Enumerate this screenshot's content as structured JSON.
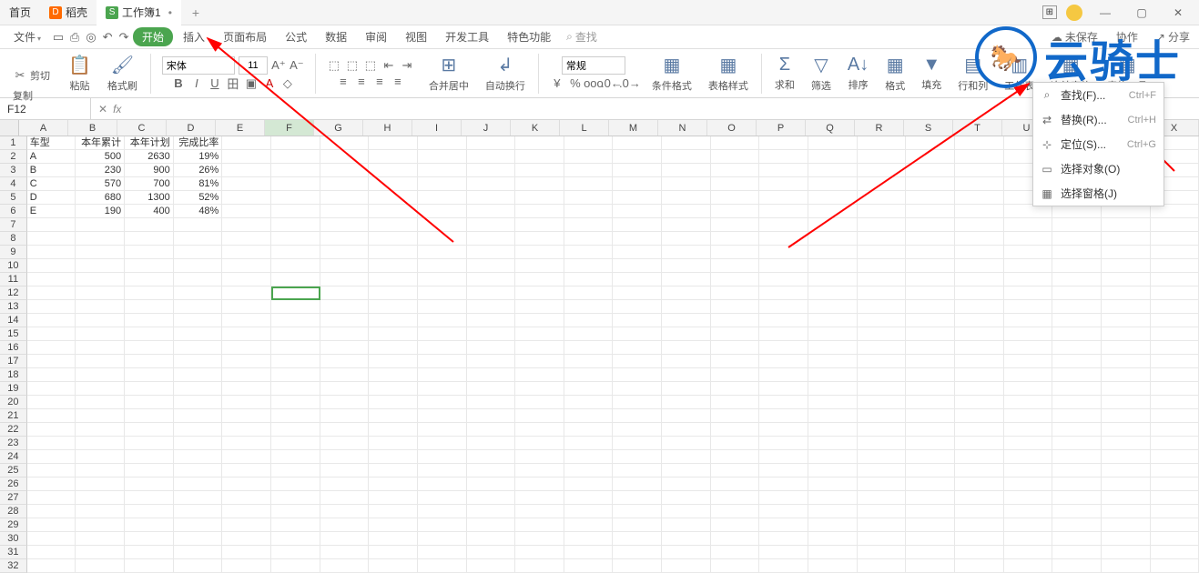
{
  "titlebar": {
    "tabs": [
      {
        "icon": "首",
        "label": "首页",
        "color": ""
      },
      {
        "icon": "D",
        "label": "稻壳",
        "color": "orange"
      },
      {
        "icon": "S",
        "label": "工作簿1",
        "color": "green",
        "active": true
      }
    ],
    "plus": "+"
  },
  "menubar": {
    "file": "文件",
    "items": [
      "开始",
      "插入",
      "页面布局",
      "公式",
      "数据",
      "审阅",
      "视图",
      "开发工具",
      "特色功能"
    ],
    "search_icon": "⌕",
    "search": "查找",
    "unsaved_icon": "☁",
    "unsaved": "未保存",
    "collab": "协作",
    "share_icon": "↗",
    "share": "分享"
  },
  "toolbar": {
    "cut": "剪切",
    "paste": "粘贴",
    "copy": "复制",
    "format_painter": "格式刷",
    "font": "宋体",
    "size": "11",
    "merge": "合并居中",
    "wrap": "自动换行",
    "number_format": "常规",
    "cond_format": "条件格式",
    "table_style": "表格样式",
    "sum": "求和",
    "filter": "筛选",
    "sort": "排序",
    "format": "格式",
    "fill": "填充",
    "row_col": "行和列",
    "sheet": "工作表",
    "freeze": "冻结窗格",
    "table_tools": "表格工具"
  },
  "formula_bar": {
    "cell": "F12",
    "fx": "fx"
  },
  "columns": [
    "A",
    "B",
    "C",
    "D",
    "E",
    "F",
    "G",
    "H",
    "I",
    "J",
    "K",
    "L",
    "M",
    "N",
    "O",
    "P",
    "Q",
    "R",
    "S",
    "T",
    "U",
    "V",
    "W",
    "X"
  ],
  "active_col_index": 5,
  "selected_cell": {
    "row": 12,
    "col": 5
  },
  "data_rows": [
    {
      "h": "1",
      "cells": [
        "车型",
        "本年累计",
        "本年计划",
        "完成比率",
        "",
        "",
        "",
        "",
        "",
        "",
        "",
        "",
        "",
        "",
        "",
        "",
        "",
        "",
        "",
        "",
        "",
        "",
        "",
        ""
      ]
    },
    {
      "h": "2",
      "cells": [
        "A",
        "500",
        "2630",
        "19%",
        "",
        "",
        "",
        "",
        "",
        "",
        "",
        "",
        "",
        "",
        "",
        "",
        "",
        "",
        "",
        "",
        "",
        "",
        "",
        ""
      ]
    },
    {
      "h": "3",
      "cells": [
        "B",
        "230",
        "900",
        "26%",
        "",
        "",
        "",
        "",
        "",
        "",
        "",
        "",
        "",
        "",
        "",
        "",
        "",
        "",
        "",
        "",
        "",
        "",
        "",
        ""
      ]
    },
    {
      "h": "4",
      "cells": [
        "C",
        "570",
        "700",
        "81%",
        "",
        "",
        "",
        "",
        "",
        "",
        "",
        "",
        "",
        "",
        "",
        "",
        "",
        "",
        "",
        "",
        "",
        "",
        "",
        ""
      ]
    },
    {
      "h": "5",
      "cells": [
        "D",
        "680",
        "1300",
        "52%",
        "",
        "",
        "",
        "",
        "",
        "",
        "",
        "",
        "",
        "",
        "",
        "",
        "",
        "",
        "",
        "",
        "",
        "",
        "",
        ""
      ]
    },
    {
      "h": "6",
      "cells": [
        "E",
        "190",
        "400",
        "48%",
        "",
        "",
        "",
        "",
        "",
        "",
        "",
        "",
        "",
        "",
        "",
        "",
        "",
        "",
        "",
        "",
        "",
        "",
        "",
        ""
      ]
    }
  ],
  "context_menu": {
    "items": [
      {
        "icon": "⌕",
        "label": "查找(F)...",
        "shortcut": "Ctrl+F"
      },
      {
        "icon": "⇄",
        "label": "替换(R)...",
        "shortcut": "Ctrl+H"
      },
      {
        "icon": "⊹",
        "label": "定位(S)...",
        "shortcut": "Ctrl+G"
      },
      {
        "icon": "▭",
        "label": "选择对象(O)",
        "shortcut": ""
      },
      {
        "icon": "▦",
        "label": "选择窗格(J)",
        "shortcut": ""
      }
    ]
  },
  "watermark": {
    "text": "云骑士"
  }
}
